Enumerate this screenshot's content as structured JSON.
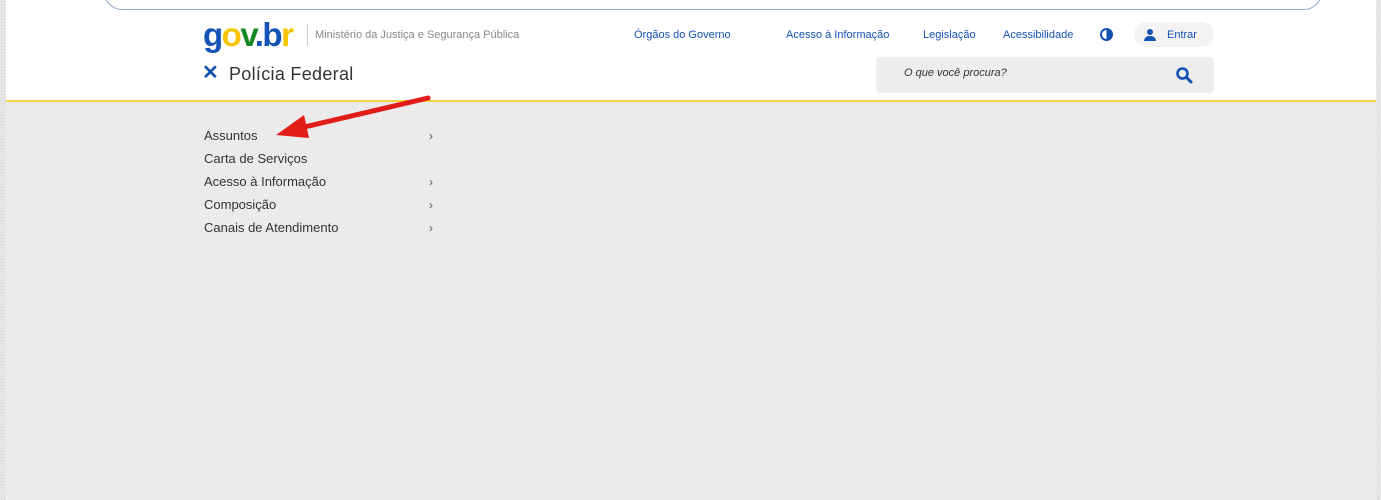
{
  "header": {
    "logo": {
      "g": "g",
      "o": "o",
      "v": "v",
      "dot": ".",
      "b": "b",
      "r": "r"
    },
    "ministry": "Ministério da Justiça e Segurança Pública",
    "links": [
      "Órgãos do Governo",
      "Acesso à Informação",
      "Legislação",
      "Acessibilidade"
    ],
    "login_label": "Entrar",
    "site_name": "Polícia Federal",
    "search_placeholder": "O que você procura?"
  },
  "menu": {
    "items": [
      {
        "label": "Assuntos",
        "chevron": "›"
      },
      {
        "label": "Carta de Serviços",
        "chevron": ""
      },
      {
        "label": "Acesso à Informação",
        "chevron": "›"
      },
      {
        "label": "Composição",
        "chevron": "›"
      },
      {
        "label": "Canais de Atendimento",
        "chevron": "›"
      }
    ]
  },
  "icons": {
    "close": "✕",
    "contrast": "contrast-icon",
    "user": "user-icon",
    "search": "search-icon"
  },
  "colors": {
    "primary": "#1351b4",
    "accent_border": "#f7d23e",
    "annotation_arrow": "#e21b1b"
  }
}
